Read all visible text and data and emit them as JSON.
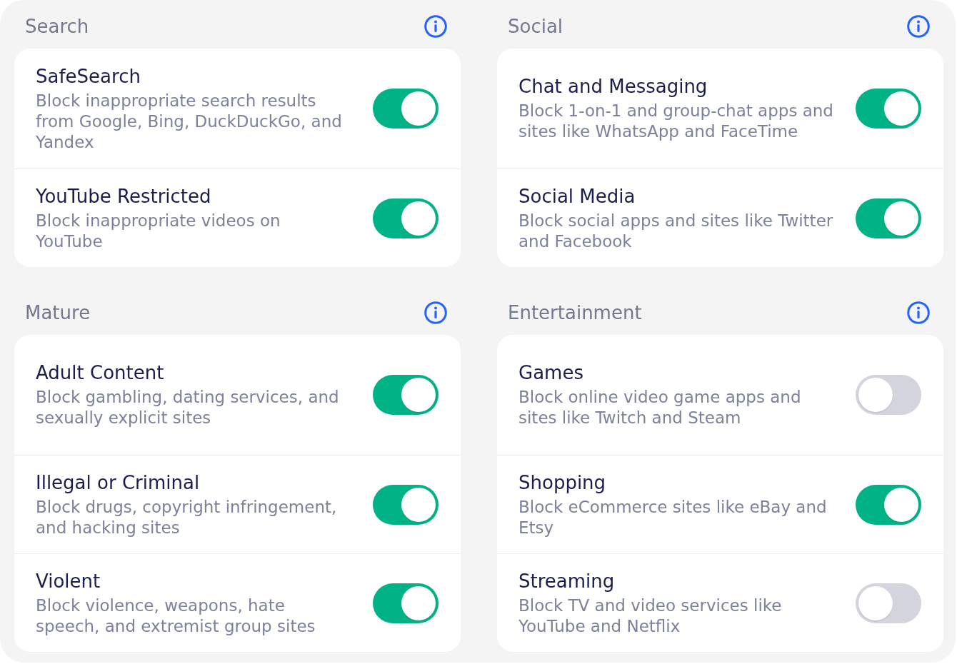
{
  "sections": [
    {
      "title": "Search",
      "items": [
        {
          "title": "SafeSearch",
          "description": "Block inappropriate search results from Google, Bing, DuckDuckGo, and Yandex",
          "on": true
        },
        {
          "title": "YouTube Restricted",
          "description": "Block inappropriate videos on YouTube",
          "on": true
        }
      ]
    },
    {
      "title": "Social",
      "items": [
        {
          "title": "Chat and Messaging",
          "description": "Block 1-on-1 and group-chat apps and sites like WhatsApp and FaceTime",
          "on": true
        },
        {
          "title": "Social Media",
          "description": "Block social apps and sites like Twitter and Facebook",
          "on": true
        }
      ]
    },
    {
      "title": "Mature",
      "items": [
        {
          "title": "Adult Content",
          "description": "Block gambling, dating services, and sexually explicit sites",
          "on": true
        },
        {
          "title": "Illegal or Criminal",
          "description": "Block drugs, copyright infringement, and hacking sites",
          "on": true
        },
        {
          "title": "Violent",
          "description": "Block violence, weapons, hate speech, and extremist group sites",
          "on": true
        }
      ]
    },
    {
      "title": "Entertainment",
      "items": [
        {
          "title": "Games",
          "description": "Block online video game apps and sites like Twitch and Steam",
          "on": false
        },
        {
          "title": "Shopping",
          "description": "Block eCommerce sites like eBay and Etsy",
          "on": true
        },
        {
          "title": "Streaming",
          "description": "Block TV and video services like YouTube and Netflix",
          "on": false
        }
      ]
    }
  ]
}
